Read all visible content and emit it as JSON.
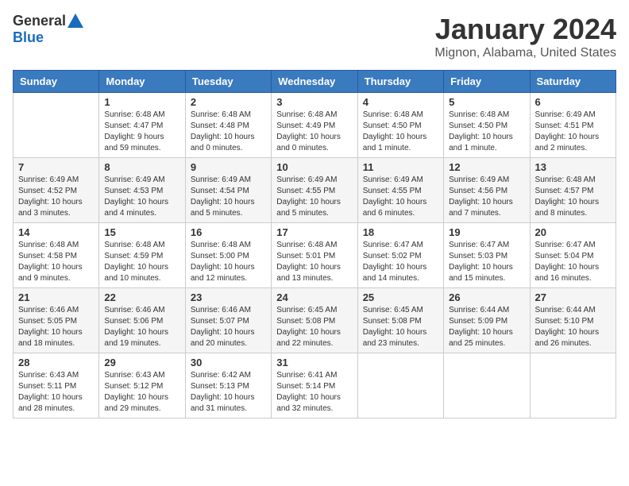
{
  "logo": {
    "general": "General",
    "blue": "Blue"
  },
  "title": "January 2024",
  "subtitle": "Mignon, Alabama, United States",
  "days_of_week": [
    "Sunday",
    "Monday",
    "Tuesday",
    "Wednesday",
    "Thursday",
    "Friday",
    "Saturday"
  ],
  "weeks": [
    [
      {
        "day": "",
        "info": ""
      },
      {
        "day": "1",
        "info": "Sunrise: 6:48 AM\nSunset: 4:47 PM\nDaylight: 9 hours\nand 59 minutes."
      },
      {
        "day": "2",
        "info": "Sunrise: 6:48 AM\nSunset: 4:48 PM\nDaylight: 10 hours\nand 0 minutes."
      },
      {
        "day": "3",
        "info": "Sunrise: 6:48 AM\nSunset: 4:49 PM\nDaylight: 10 hours\nand 0 minutes."
      },
      {
        "day": "4",
        "info": "Sunrise: 6:48 AM\nSunset: 4:50 PM\nDaylight: 10 hours\nand 1 minute."
      },
      {
        "day": "5",
        "info": "Sunrise: 6:48 AM\nSunset: 4:50 PM\nDaylight: 10 hours\nand 1 minute."
      },
      {
        "day": "6",
        "info": "Sunrise: 6:49 AM\nSunset: 4:51 PM\nDaylight: 10 hours\nand 2 minutes."
      }
    ],
    [
      {
        "day": "7",
        "info": "Sunrise: 6:49 AM\nSunset: 4:52 PM\nDaylight: 10 hours\nand 3 minutes."
      },
      {
        "day": "8",
        "info": "Sunrise: 6:49 AM\nSunset: 4:53 PM\nDaylight: 10 hours\nand 4 minutes."
      },
      {
        "day": "9",
        "info": "Sunrise: 6:49 AM\nSunset: 4:54 PM\nDaylight: 10 hours\nand 5 minutes."
      },
      {
        "day": "10",
        "info": "Sunrise: 6:49 AM\nSunset: 4:55 PM\nDaylight: 10 hours\nand 5 minutes."
      },
      {
        "day": "11",
        "info": "Sunrise: 6:49 AM\nSunset: 4:55 PM\nDaylight: 10 hours\nand 6 minutes."
      },
      {
        "day": "12",
        "info": "Sunrise: 6:49 AM\nSunset: 4:56 PM\nDaylight: 10 hours\nand 7 minutes."
      },
      {
        "day": "13",
        "info": "Sunrise: 6:48 AM\nSunset: 4:57 PM\nDaylight: 10 hours\nand 8 minutes."
      }
    ],
    [
      {
        "day": "14",
        "info": "Sunrise: 6:48 AM\nSunset: 4:58 PM\nDaylight: 10 hours\nand 9 minutes."
      },
      {
        "day": "15",
        "info": "Sunrise: 6:48 AM\nSunset: 4:59 PM\nDaylight: 10 hours\nand 10 minutes."
      },
      {
        "day": "16",
        "info": "Sunrise: 6:48 AM\nSunset: 5:00 PM\nDaylight: 10 hours\nand 12 minutes."
      },
      {
        "day": "17",
        "info": "Sunrise: 6:48 AM\nSunset: 5:01 PM\nDaylight: 10 hours\nand 13 minutes."
      },
      {
        "day": "18",
        "info": "Sunrise: 6:47 AM\nSunset: 5:02 PM\nDaylight: 10 hours\nand 14 minutes."
      },
      {
        "day": "19",
        "info": "Sunrise: 6:47 AM\nSunset: 5:03 PM\nDaylight: 10 hours\nand 15 minutes."
      },
      {
        "day": "20",
        "info": "Sunrise: 6:47 AM\nSunset: 5:04 PM\nDaylight: 10 hours\nand 16 minutes."
      }
    ],
    [
      {
        "day": "21",
        "info": "Sunrise: 6:46 AM\nSunset: 5:05 PM\nDaylight: 10 hours\nand 18 minutes."
      },
      {
        "day": "22",
        "info": "Sunrise: 6:46 AM\nSunset: 5:06 PM\nDaylight: 10 hours\nand 19 minutes."
      },
      {
        "day": "23",
        "info": "Sunrise: 6:46 AM\nSunset: 5:07 PM\nDaylight: 10 hours\nand 20 minutes."
      },
      {
        "day": "24",
        "info": "Sunrise: 6:45 AM\nSunset: 5:08 PM\nDaylight: 10 hours\nand 22 minutes."
      },
      {
        "day": "25",
        "info": "Sunrise: 6:45 AM\nSunset: 5:08 PM\nDaylight: 10 hours\nand 23 minutes."
      },
      {
        "day": "26",
        "info": "Sunrise: 6:44 AM\nSunset: 5:09 PM\nDaylight: 10 hours\nand 25 minutes."
      },
      {
        "day": "27",
        "info": "Sunrise: 6:44 AM\nSunset: 5:10 PM\nDaylight: 10 hours\nand 26 minutes."
      }
    ],
    [
      {
        "day": "28",
        "info": "Sunrise: 6:43 AM\nSunset: 5:11 PM\nDaylight: 10 hours\nand 28 minutes."
      },
      {
        "day": "29",
        "info": "Sunrise: 6:43 AM\nSunset: 5:12 PM\nDaylight: 10 hours\nand 29 minutes."
      },
      {
        "day": "30",
        "info": "Sunrise: 6:42 AM\nSunset: 5:13 PM\nDaylight: 10 hours\nand 31 minutes."
      },
      {
        "day": "31",
        "info": "Sunrise: 6:41 AM\nSunset: 5:14 PM\nDaylight: 10 hours\nand 32 minutes."
      },
      {
        "day": "",
        "info": ""
      },
      {
        "day": "",
        "info": ""
      },
      {
        "day": "",
        "info": ""
      }
    ]
  ]
}
